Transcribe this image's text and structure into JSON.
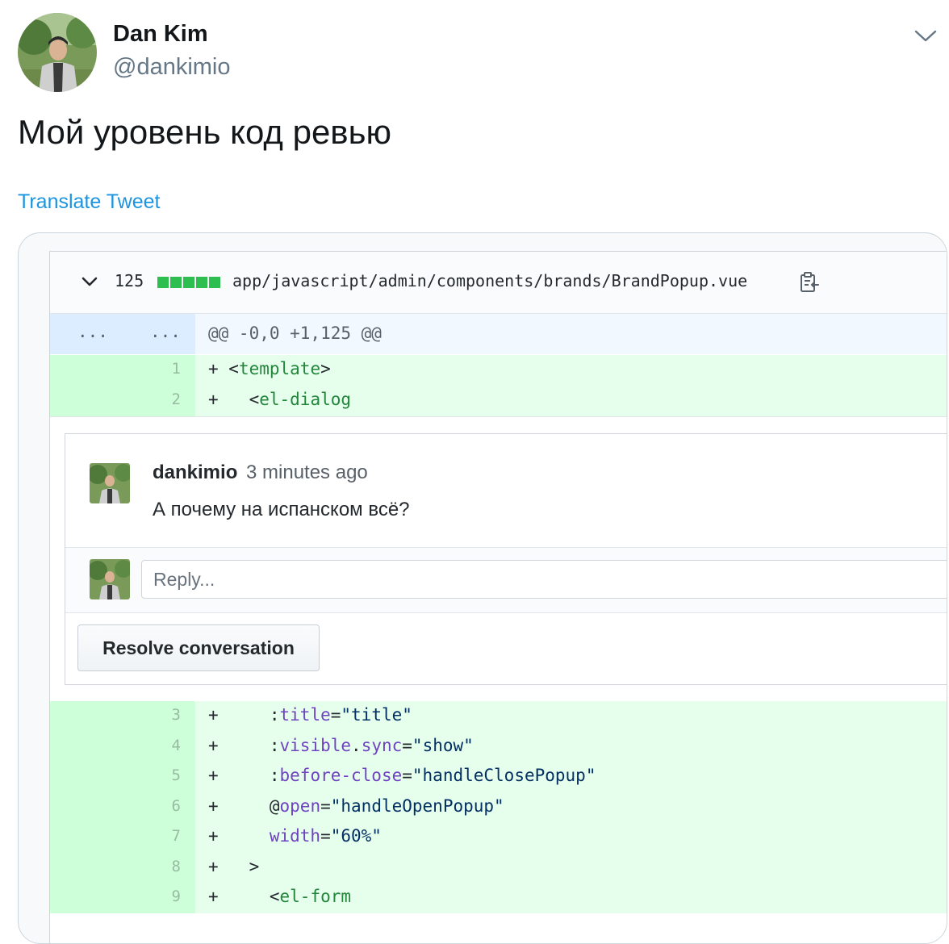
{
  "tweet": {
    "display_name": "Dan Kim",
    "handle": "@dankimio",
    "text": "Мой уровень код ревью",
    "translate_link": "Translate Tweet"
  },
  "diff": {
    "file": {
      "line_count": "125",
      "path": "app/javascript/admin/components/brands/BrandPopup.vue"
    },
    "hunk": {
      "left_dots": "...",
      "right_dots": "...",
      "header": "@@ -0,0 +1,125 @@"
    },
    "lines_top": [
      {
        "num": "1",
        "marker": "+",
        "indent": " ",
        "parts": [
          {
            "c": "t-plain",
            "t": "<"
          },
          {
            "c": "t-tag",
            "t": "template"
          },
          {
            "c": "t-plain",
            "t": ">"
          }
        ]
      },
      {
        "num": "2",
        "marker": "+",
        "indent": "   ",
        "parts": [
          {
            "c": "t-plain",
            "t": "<"
          },
          {
            "c": "t-tag",
            "t": "el-dialog"
          }
        ]
      }
    ],
    "comment": {
      "author": "dankimio",
      "time": "3 minutes ago",
      "body": "А почему на испанском всё?",
      "reply_placeholder": "Reply...",
      "resolve_label": "Resolve conversation"
    },
    "lines_bottom": [
      {
        "num": "3",
        "marker": "+",
        "indent": "     ",
        "parts": [
          {
            "c": "t-plain",
            "t": ":"
          },
          {
            "c": "t-attr",
            "t": "title"
          },
          {
            "c": "t-plain",
            "t": "="
          },
          {
            "c": "t-str",
            "t": "\"title\""
          }
        ]
      },
      {
        "num": "4",
        "marker": "+",
        "indent": "     ",
        "parts": [
          {
            "c": "t-plain",
            "t": ":"
          },
          {
            "c": "t-attr",
            "t": "visible"
          },
          {
            "c": "t-plain",
            "t": "."
          },
          {
            "c": "t-attr",
            "t": "sync"
          },
          {
            "c": "t-plain",
            "t": "="
          },
          {
            "c": "t-str",
            "t": "\"show\""
          }
        ]
      },
      {
        "num": "5",
        "marker": "+",
        "indent": "     ",
        "parts": [
          {
            "c": "t-plain",
            "t": ":"
          },
          {
            "c": "t-attr",
            "t": "before-close"
          },
          {
            "c": "t-plain",
            "t": "="
          },
          {
            "c": "t-str",
            "t": "\"handleClosePopup\""
          }
        ]
      },
      {
        "num": "6",
        "marker": "+",
        "indent": "     ",
        "parts": [
          {
            "c": "t-plain",
            "t": "@"
          },
          {
            "c": "t-attr",
            "t": "open"
          },
          {
            "c": "t-plain",
            "t": "="
          },
          {
            "c": "t-str",
            "t": "\"handleOpenPopup\""
          }
        ]
      },
      {
        "num": "7",
        "marker": "+",
        "indent": "     ",
        "parts": [
          {
            "c": "t-attr",
            "t": "width"
          },
          {
            "c": "t-plain",
            "t": "="
          },
          {
            "c": "t-str",
            "t": "\"60%\""
          }
        ]
      },
      {
        "num": "8",
        "marker": "+",
        "indent": "   ",
        "parts": [
          {
            "c": "t-plain",
            "t": ">"
          }
        ]
      },
      {
        "num": "9",
        "marker": "+",
        "indent": "     ",
        "parts": [
          {
            "c": "t-plain",
            "t": "<"
          },
          {
            "c": "t-tag",
            "t": "el-form"
          }
        ]
      }
    ]
  },
  "colors": {
    "link": "#1b95e0",
    "added_bg": "#e6ffed",
    "added_gutter": "#cdffd8",
    "hunk_bg": "#f1f8ff",
    "diffstat_green": "#2cbe4e"
  },
  "icons": [
    "chevron-down-icon",
    "clipboard-icon"
  ]
}
